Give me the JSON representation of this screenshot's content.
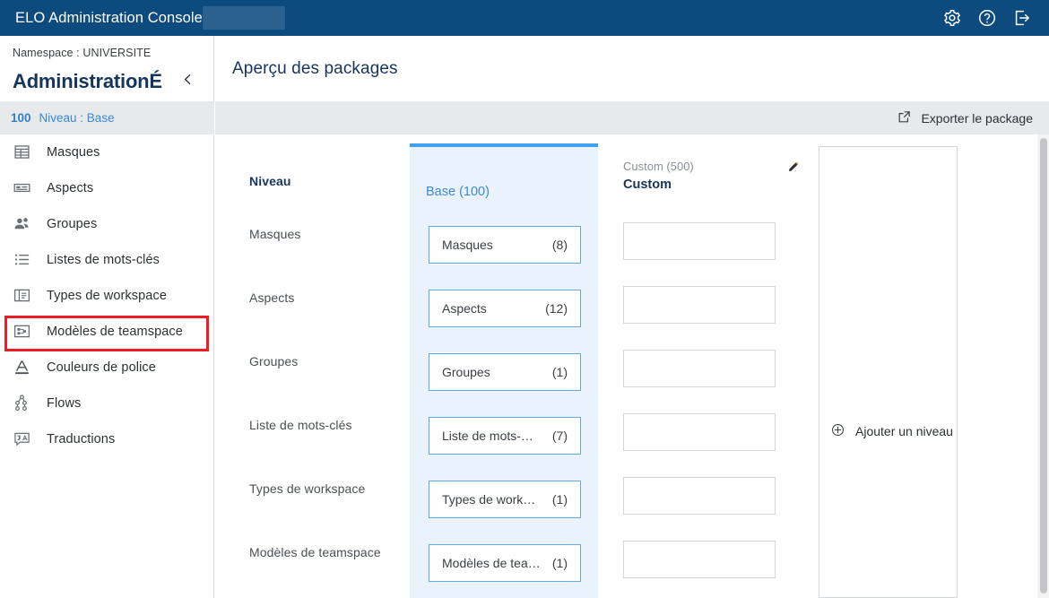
{
  "topbar": {
    "title": "ELO Administration Console",
    "redacted_block": "",
    "icons": [
      {
        "name": "settings-gear-icon",
        "label": "Paramètres"
      },
      {
        "name": "help-question-icon",
        "label": "Aide"
      },
      {
        "name": "logout-icon",
        "label": "Déconnexion"
      }
    ]
  },
  "sidebar": {
    "namespace_label": "Namespace : UNIVERSITE",
    "title": "AdministrationÉ",
    "collapse_icon": "chevron-left-icon",
    "breadcrumb": {
      "number": "100",
      "label": "Niveau : Base"
    },
    "items": [
      {
        "label": "Masques",
        "icon": "table-grid-icon",
        "selected": false
      },
      {
        "label": "Aspects",
        "icon": "card-list-icon",
        "selected": false
      },
      {
        "label": "Groupes",
        "icon": "users-icon",
        "selected": false
      },
      {
        "label": "Listes de mots-clés",
        "icon": "bullet-list-icon",
        "selected": false
      },
      {
        "label": "Types de workspace",
        "icon": "workspace-icon",
        "selected": true
      },
      {
        "label": "Modèles de teamspace",
        "icon": "teamspace-icon",
        "selected": false
      },
      {
        "label": "Couleurs de police",
        "icon": "font-color-icon",
        "selected": false
      },
      {
        "label": "Flows",
        "icon": "flow-nodes-icon",
        "selected": false
      },
      {
        "label": "Traductions",
        "icon": "translate-icon",
        "selected": false
      }
    ]
  },
  "content": {
    "page_title": "Aperçu des packages",
    "export_button": {
      "label": "Exporter le package",
      "icon": "external-link-icon"
    },
    "row_header_label": "Niveau",
    "row_labels": [
      "Masques",
      "Aspects",
      "Groupes",
      "Liste de mots-clés",
      "Types de workspace",
      "Modèles de teamspace"
    ],
    "columns": [
      {
        "id": "base",
        "title": "Base (100)",
        "meta": "",
        "name": "",
        "active": true,
        "chips": [
          {
            "name": "Masques",
            "count": "(8)"
          },
          {
            "name": "Aspects",
            "count": "(12)"
          },
          {
            "name": "Groupes",
            "count": "(1)"
          },
          {
            "name": "Liste de mots-…",
            "count": "(7)"
          },
          {
            "name": "Types de work…",
            "count": "(1)"
          },
          {
            "name": "Modèles de tea…",
            "count": "(1)"
          }
        ]
      },
      {
        "id": "custom",
        "title": "",
        "meta": "Custom (500)",
        "name": "Custom",
        "edit_icon": "pencil-icon",
        "active": false,
        "slots": [
          "",
          "",
          "",
          "",
          "",
          ""
        ]
      }
    ],
    "add_level": {
      "label": "Ajouter un niveau",
      "icon": "plus-circle-icon"
    }
  },
  "colors": {
    "topbar_bg": "#0d4a7d",
    "accent_blue": "#3a8ad4",
    "column_active_bg": "#eaf3fd",
    "column_active_border": "#3fa0f0",
    "highlight_red": "#ee1c25",
    "breadcrumb_bg": "#e8e9eb",
    "dark_blue_text": "#15355c"
  }
}
